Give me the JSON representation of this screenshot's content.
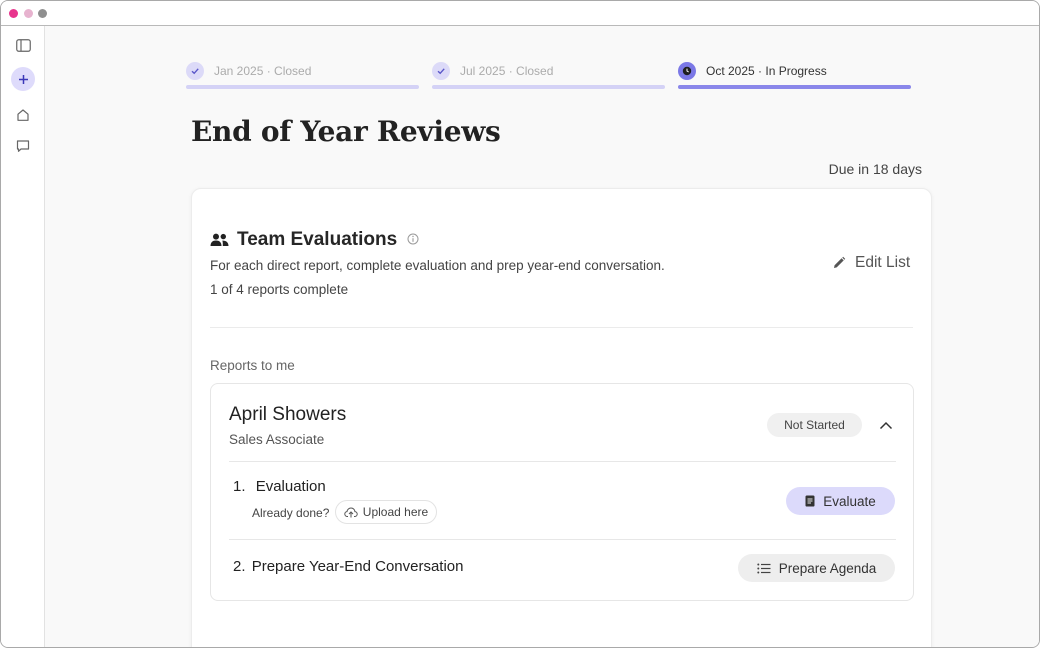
{
  "steps": [
    {
      "label": "Jan 2025 · Closed",
      "state": "closed"
    },
    {
      "label": "Jul 2025 · Closed",
      "state": "closed"
    },
    {
      "label": "Oct 2025 · In Progress",
      "state": "in-progress"
    }
  ],
  "page": {
    "title": "End of Year Reviews",
    "due": "Due in 18 days"
  },
  "card": {
    "title": "Team Evaluations",
    "description": "For each direct report, complete  evaluation and prep year-end conversation.",
    "progress": "1 of 4 reports complete",
    "edit_label": "Edit List",
    "section_label": "Reports to me"
  },
  "report": {
    "name": "April Showers",
    "role": "Sales Associate",
    "status": "Not Started",
    "tasks": [
      {
        "number": "1.",
        "title": "Evaluation",
        "helper": "Already done?",
        "upload_label": "Upload here",
        "action_label": "Evaluate"
      },
      {
        "number": "2.",
        "title": "Prepare Year-End Conversation",
        "action_label": "Prepare Agenda"
      }
    ]
  },
  "colors": {
    "accent": "#7b78e6",
    "accent_light": "#dcdaf8",
    "window_dot_red": "#e8358d",
    "window_dot_pink": "#e7b3cf",
    "window_dot_gray": "#8f8f8f"
  },
  "icons": {
    "sidebar": [
      "sidebar-toggle-icon",
      "plus-icon",
      "home-icon",
      "chat-icon"
    ],
    "team": "people-icon",
    "info": "info-icon",
    "edit": "pencil-icon",
    "collapse": "chevron-up-icon",
    "upload": "cloud-upload-icon",
    "evaluate": "document-icon",
    "prepare": "list-icon"
  }
}
